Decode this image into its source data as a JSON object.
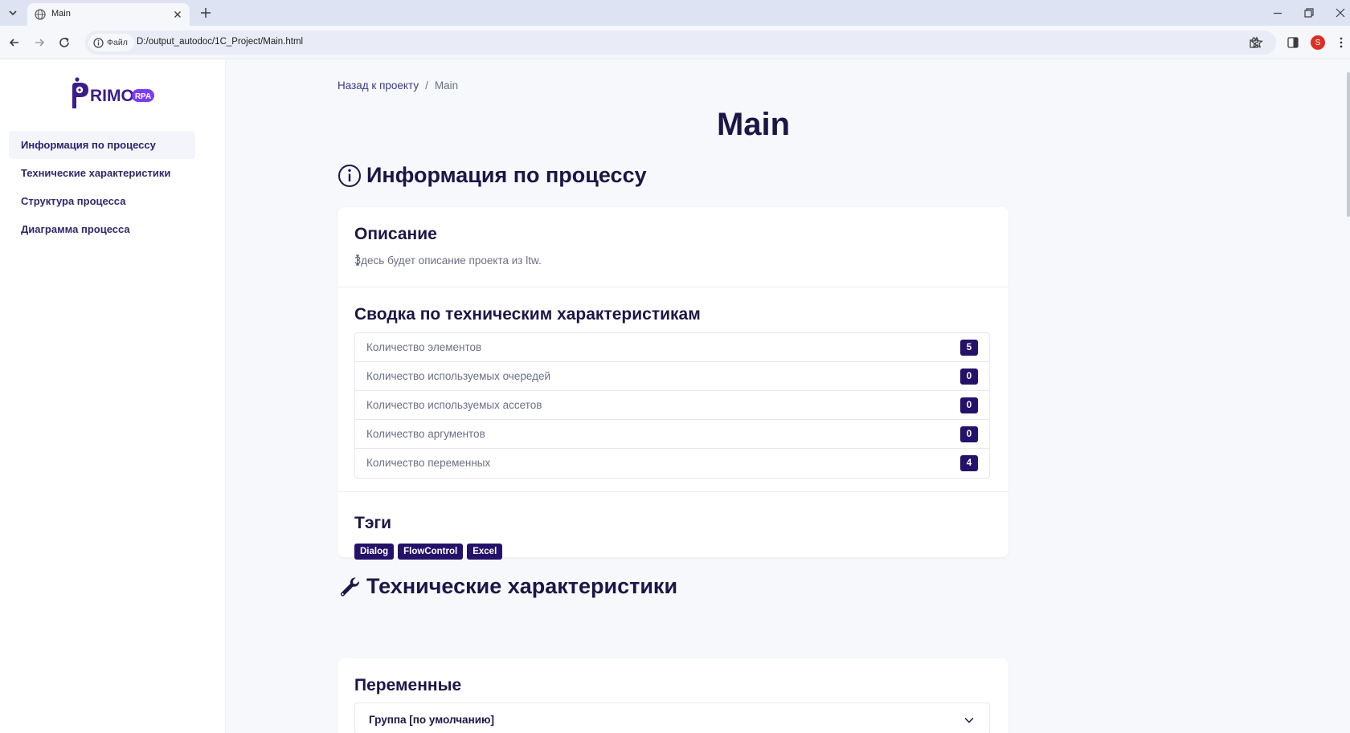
{
  "browser": {
    "tab_title": "Main",
    "site_chip": "Файл",
    "url": "D:/output_autodoc/1C_Project/Main.html",
    "profile_initial": "S"
  },
  "sidebar": {
    "logo_text": "PRIMO",
    "logo_badge": "RPA",
    "items": [
      {
        "label": "Информация по процессу",
        "active": true
      },
      {
        "label": "Технические характеристики",
        "active": false
      },
      {
        "label": "Структура процесса",
        "active": false
      },
      {
        "label": "Диаграмма процесса",
        "active": false
      }
    ]
  },
  "breadcrumb": {
    "back": "Назад к проекту",
    "separator": "/",
    "current": "Main"
  },
  "page_title": "Main",
  "process_info": {
    "heading": "Информация по процессу",
    "description": {
      "heading": "Описание",
      "text": "Здесь будет описание проекта из ltw."
    },
    "summary": {
      "heading": "Сводка по техническим характеристикам",
      "rows": [
        {
          "label": "Количество элементов",
          "value": "5"
        },
        {
          "label": "Количество используемых очередей",
          "value": "0"
        },
        {
          "label": "Количество используемых ассетов",
          "value": "0"
        },
        {
          "label": "Количество аргументов",
          "value": "0"
        },
        {
          "label": "Количество переменных",
          "value": "4"
        }
      ]
    },
    "tags": {
      "heading": "Тэги",
      "items": [
        "Dialog",
        "FlowControl",
        "Excel"
      ]
    }
  },
  "tech": {
    "heading": "Технические характеристики",
    "variables": {
      "heading": "Переменные",
      "group_label": "Группа [по умолчанию]"
    }
  },
  "colors": {
    "accent": "#24126a",
    "heading": "#1c1647",
    "muted": "#6b6f86",
    "page_bg": "#f7f8fb"
  }
}
